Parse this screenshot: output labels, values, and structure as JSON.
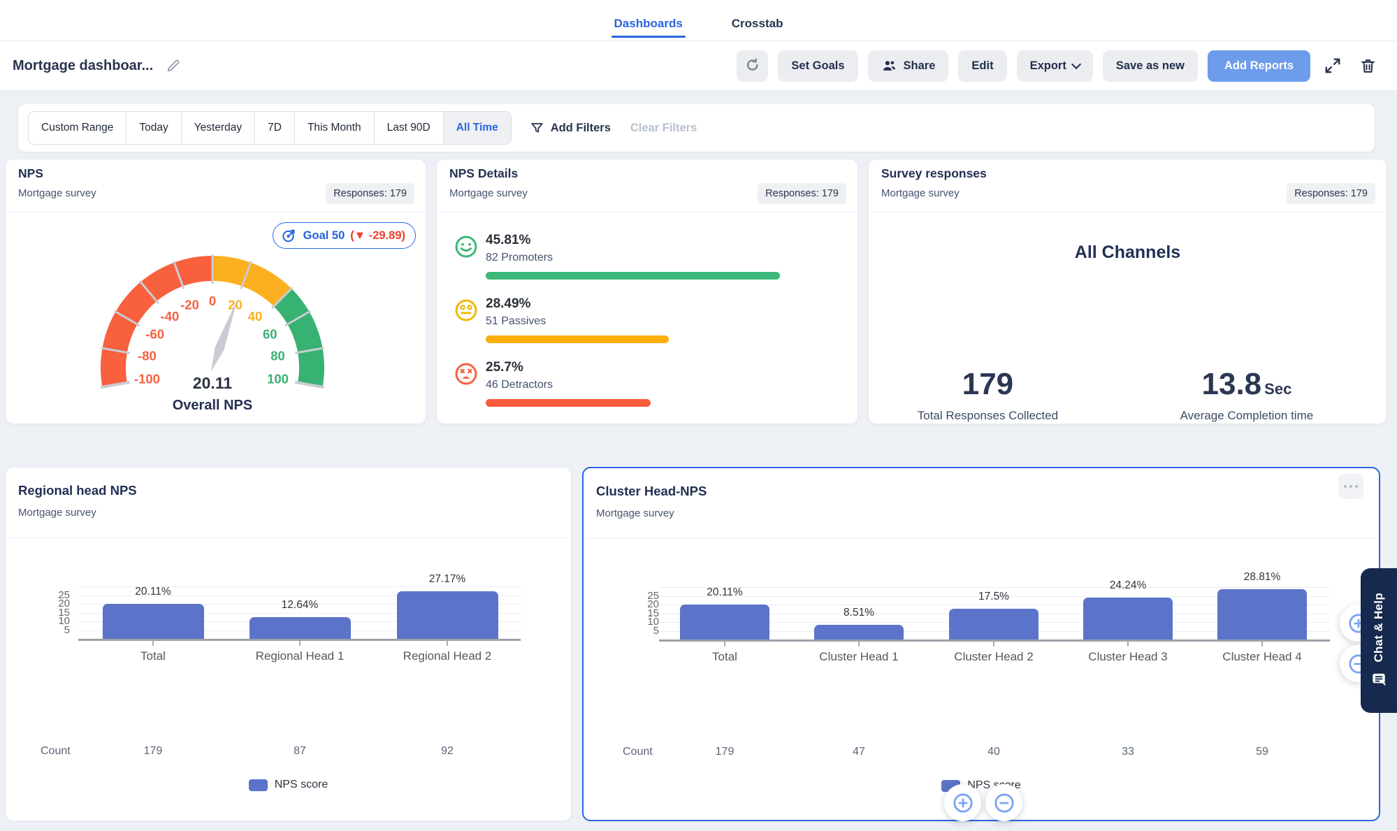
{
  "header": {
    "tabs": [
      {
        "label": "Dashboards"
      },
      {
        "label": "Crosstab"
      }
    ]
  },
  "toolbar": {
    "title": "Mortgage dashboar...",
    "set_goals": "Set Goals",
    "share": "Share",
    "edit": "Edit",
    "export": "Export",
    "save_as_new": "Save as new",
    "add_reports": "Add Reports"
  },
  "filterbar": {
    "ranges": [
      "Custom Range",
      "Today",
      "Yesterday",
      "7D",
      "This Month",
      "Last 90D",
      "All Time"
    ],
    "active": "All Time",
    "add_filters": "Add Filters",
    "clear_filters": "Clear Filters"
  },
  "cards": {
    "nps": {
      "title": "NPS",
      "subtitle": "Mortgage survey",
      "badge": "Responses: 179",
      "goal_label": "Goal 50",
      "goal_delta": "(▼ -29.89)"
    },
    "nps_details": {
      "title": "NPS Details",
      "subtitle": "Mortgage survey",
      "badge": "Responses: 179"
    },
    "survey": {
      "title": "Survey responses",
      "subtitle": "Mortgage survey",
      "badge": "Responses: 179",
      "channel": "All Channels",
      "stat1_value": "179",
      "stat1_caption": "Total Responses Collected",
      "stat2_value": "13.8",
      "stat2_unit": "Sec",
      "stat2_caption": "Average Completion time"
    },
    "regional": {
      "title": "Regional head NPS",
      "subtitle": "Mortgage survey"
    },
    "cluster": {
      "title": "Cluster Head-NPS",
      "subtitle": "Mortgage survey"
    }
  },
  "chat_help": "Chat & Help",
  "colors": {
    "accent": "#2a65df",
    "add_reports_bg": "#6d9ceb",
    "bar": "#5b74c9",
    "page_bg": "#edf0f4",
    "chat_bg": "#16294e",
    "goal_red": "#ee3f2d",
    "gauge_red": "#f8603e",
    "gauge_amber": "#fcb01f",
    "gauge_green": "#38b273"
  },
  "chart_data": [
    {
      "type": "gauge",
      "card": "nps",
      "title": "Overall NPS",
      "value": 20.11,
      "value_label": "20.11",
      "min": -100,
      "max": 100,
      "goal": 50,
      "goal_delta": -29.89,
      "segments": [
        {
          "from": -100,
          "to": 0,
          "color": "#f8603e"
        },
        {
          "from": 0,
          "to": 45,
          "color": "#fcb01f"
        },
        {
          "from": 45,
          "to": 100,
          "color": "#38b273"
        }
      ],
      "tick_labels": [
        -100,
        -80,
        -60,
        -40,
        -20,
        0,
        20,
        40,
        60,
        80,
        100
      ],
      "tick_marks": [
        -80,
        -60,
        -40,
        -20,
        0,
        20,
        45,
        60,
        80
      ],
      "needle_color": "#c9cdd3"
    },
    {
      "type": "bar",
      "card": "nps_details",
      "orientation": "horizontal",
      "rows": [
        {
          "pct": "45.81%",
          "label": "82 Promoters",
          "value": 45.81,
          "color": "#3cb878"
        },
        {
          "pct": "28.49%",
          "label": "51 Passives",
          "value": 28.49,
          "color": "#fcaf0b"
        },
        {
          "pct": "25.7%",
          "label": "46 Detractors",
          "value": 25.7,
          "color": "#f95c3b"
        }
      ]
    },
    {
      "type": "bar",
      "card": "regional",
      "categories": [
        "Total",
        "Regional Head 1",
        "Regional Head 2"
      ],
      "values": [
        20.11,
        12.64,
        27.17
      ],
      "value_labels": [
        "20.11%",
        "12.64%",
        "27.17%"
      ],
      "counts": [
        "179",
        "87",
        "92"
      ],
      "count_label": "Count",
      "legend": "NPS score",
      "yticks": [
        25,
        20,
        15,
        10,
        5
      ],
      "ylim": [
        0,
        30
      ],
      "grid": true,
      "bar_color": "#5b74c9"
    },
    {
      "type": "bar",
      "card": "cluster",
      "categories": [
        "Total",
        "Cluster Head 1",
        "Cluster Head 2",
        "Cluster Head 3",
        "Cluster Head 4"
      ],
      "values": [
        20.11,
        8.51,
        17.5,
        24.24,
        28.81
      ],
      "value_labels": [
        "20.11%",
        "8.51%",
        "17.5%",
        "24.24%",
        "28.81%"
      ],
      "counts": [
        "179",
        "47",
        "40",
        "33",
        "59"
      ],
      "count_label": "Count",
      "legend": "NPS score",
      "yticks": [
        25,
        20,
        15,
        10,
        5
      ],
      "ylim": [
        0,
        30
      ],
      "grid": true,
      "bar_color": "#5b74c9"
    }
  ]
}
